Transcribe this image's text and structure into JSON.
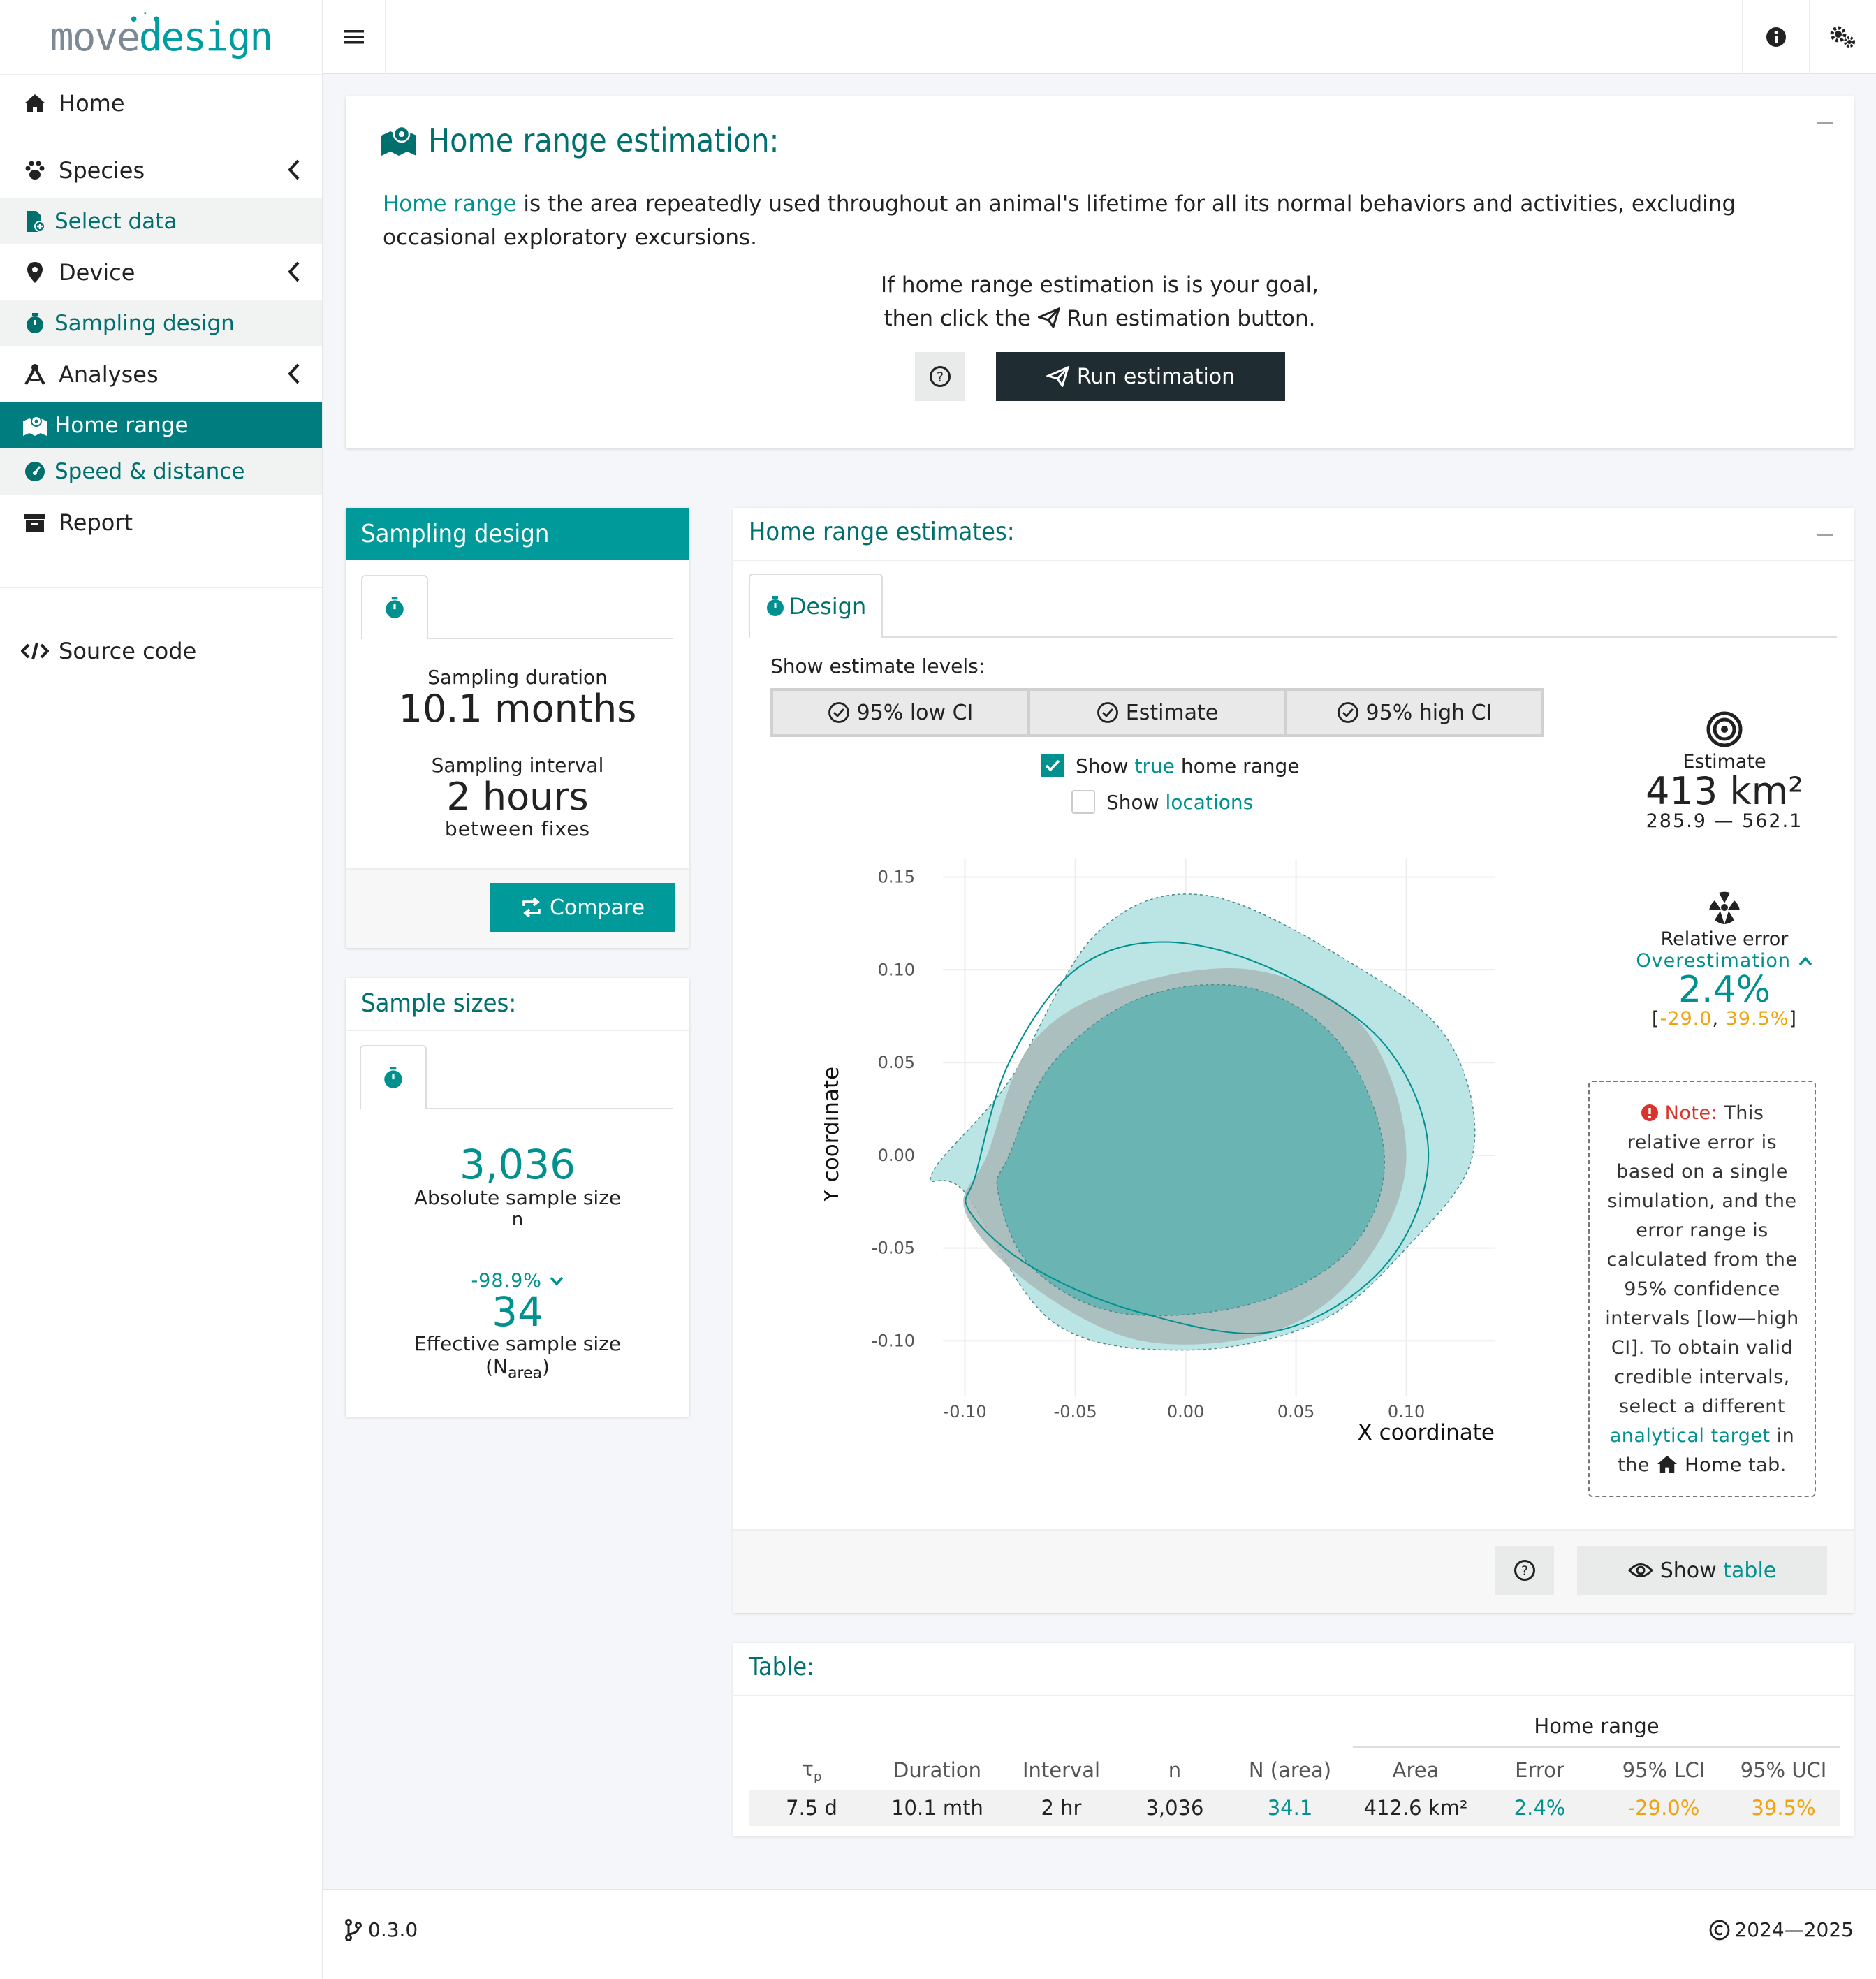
{
  "app": {
    "logo_move": "move",
    "logo_design": "design"
  },
  "sidebar": {
    "home": "Home",
    "species": "Species",
    "select_data": "Select data",
    "device": "Device",
    "sampling_design": "Sampling design",
    "analyses": "Analyses",
    "home_range": "Home range",
    "speed_distance": "Speed & distance",
    "report": "Report",
    "source_code": "Source code"
  },
  "intro": {
    "title": "Home range estimation:",
    "link": "Home range",
    "text": "is the area repeatedly used throughout an animal's lifetime for all its normal behaviors and activities, excluding occasional exploratory excursions.",
    "goal_line1": "If home range estimation is is your goal,",
    "goal_line2a": "then click the",
    "goal_line2b": "Run estimation button.",
    "run_button": "Run estimation"
  },
  "sampling": {
    "title": "Sampling design",
    "duration_label": "Sampling duration",
    "duration_value": "10.1 months",
    "interval_label": "Sampling interval",
    "interval_value": "2 hours",
    "interval_sub": "between fixes",
    "compare_button": "Compare"
  },
  "sample_sizes": {
    "title": "Sample sizes:",
    "abs_value": "3,036",
    "abs_label": "Absolute sample size",
    "abs_sub": "n",
    "change": "-98.9%",
    "eff_value": "34",
    "eff_label": "Effective sample size",
    "eff_sub_open": "(N",
    "eff_sub_sub": "area",
    "eff_sub_close": ")"
  },
  "estimates": {
    "title": "Home range estimates:",
    "tab": "Design",
    "levels_label": "Show estimate levels:",
    "levels": [
      "95% low CI",
      "Estimate",
      "95% high CI"
    ],
    "show_true_pre": "Show",
    "show_true_link": "true",
    "show_true_post": "home range",
    "show_true_checked": true,
    "show_loc_pre": "Show",
    "show_loc_link": "locations",
    "show_loc_checked": false,
    "estimate_label": "Estimate",
    "estimate_value": "413 km²",
    "estimate_range": "285.9 — 562.1",
    "rel_error_label": "Relative error",
    "rel_error_dir": "Overestimation",
    "rel_error_value": "2.4%",
    "rel_error_ci_low": "-29.0",
    "rel_error_ci_high": "39.5%",
    "note_label": "Note:",
    "note_text1": "This relative error is based on a single simulation, and the error range is calculated from the 95% confidence intervals [low—high CI]. To obtain valid credible intervals, select a different",
    "note_link": "analytical target",
    "note_text2": "in the",
    "note_home": "Home",
    "note_text3": "tab.",
    "show_table_pre": "Show",
    "show_table_link": "table"
  },
  "chart_data": {
    "type": "area",
    "xlabel": "X coordinate",
    "ylabel": "Y coordinate",
    "x_ticks": [
      "-0.10",
      "-0.05",
      "0.00",
      "0.05",
      "0.10"
    ],
    "y_ticks": [
      "0.15",
      "0.10",
      "0.05",
      "0.00",
      "-0.05",
      "-0.10"
    ],
    "xlim": [
      -0.11,
      0.14
    ],
    "ylim": [
      -0.13,
      0.16
    ],
    "grid": true,
    "series": [
      {
        "color": "#b7e3e3",
        "style": "dashed",
        "points": [
          [
            -0.1,
            -0.02
          ],
          [
            -0.06,
            -0.09
          ],
          [
            0.0,
            -0.105
          ],
          [
            0.06,
            -0.09
          ],
          [
            0.1,
            -0.05
          ],
          [
            0.13,
            0.0
          ],
          [
            0.12,
            0.06
          ],
          [
            0.08,
            0.1
          ],
          [
            0.01,
            0.14
          ],
          [
            -0.04,
            0.12
          ],
          [
            -0.08,
            0.04
          ],
          [
            -0.115,
            -0.01
          ]
        ]
      },
      {
        "color": "#a8b9b9",
        "style": "fill",
        "points": [
          [
            -0.09,
            0.0
          ],
          [
            -0.07,
            0.06
          ],
          [
            -0.03,
            0.09
          ],
          [
            0.03,
            0.1
          ],
          [
            0.08,
            0.07
          ],
          [
            0.1,
            0.0
          ],
          [
            0.08,
            -0.06
          ],
          [
            0.04,
            -0.095
          ],
          [
            -0.02,
            -0.1
          ],
          [
            -0.07,
            -0.07
          ],
          [
            -0.1,
            -0.03
          ]
        ]
      },
      {
        "color": "#5fb2b1",
        "style": "dashed",
        "points": [
          [
            -0.08,
            0.0
          ],
          [
            -0.06,
            0.05
          ],
          [
            -0.02,
            0.085
          ],
          [
            0.03,
            0.09
          ],
          [
            0.07,
            0.06
          ],
          [
            0.09,
            0.0
          ],
          [
            0.075,
            -0.05
          ],
          [
            0.03,
            -0.08
          ],
          [
            -0.03,
            -0.085
          ],
          [
            -0.07,
            -0.06
          ],
          [
            -0.085,
            -0.02
          ]
        ]
      },
      {
        "color": "#00918f",
        "style": "line",
        "points": [
          [
            -0.095,
            -0.01
          ],
          [
            -0.08,
            0.05
          ],
          [
            -0.05,
            0.1
          ],
          [
            -0.01,
            0.115
          ],
          [
            0.04,
            0.1
          ],
          [
            0.09,
            0.06
          ],
          [
            0.11,
            0.0
          ],
          [
            0.09,
            -0.06
          ],
          [
            0.04,
            -0.095
          ],
          [
            -0.02,
            -0.085
          ],
          [
            -0.07,
            -0.06
          ],
          [
            -0.098,
            -0.03
          ]
        ]
      }
    ]
  },
  "table": {
    "title": "Table:",
    "group_header": "Home range",
    "headers": [
      "τp",
      "Duration",
      "Interval",
      "n",
      "N (area)",
      "Area",
      "Error",
      "95% LCI",
      "95% UCI"
    ],
    "row": [
      "7.5 d",
      "10.1 mth",
      "2 hr",
      "3,036",
      "34.1",
      "412.6 km²",
      "2.4%",
      "-29.0%",
      "39.5%"
    ]
  },
  "footer": {
    "version": "0.3.0",
    "copyright": "2024—2025"
  }
}
